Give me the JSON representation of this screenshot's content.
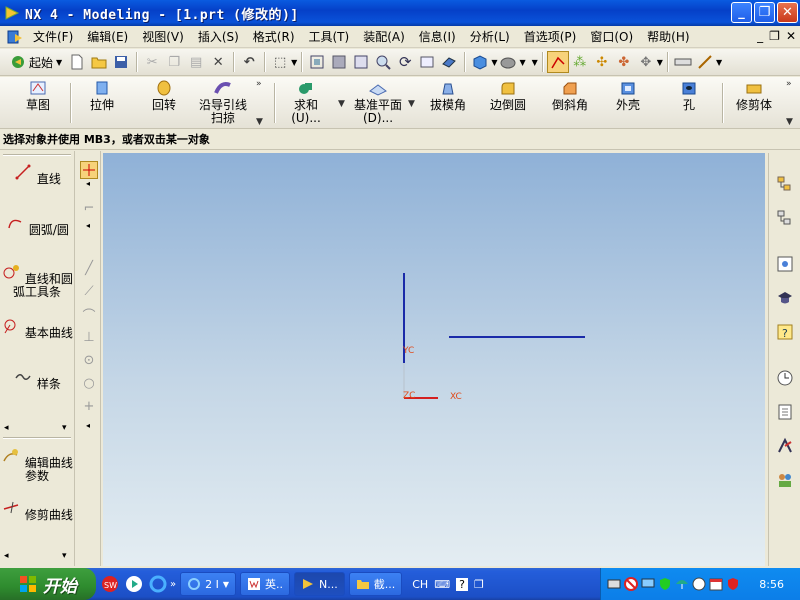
{
  "window": {
    "title": "NX 4 - Modeling - [1.prt (修改的)]",
    "minimize": "_",
    "restore": "❐",
    "close": "✕"
  },
  "menubar": {
    "items": [
      "文件(F)",
      "编辑(E)",
      "视图(V)",
      "插入(S)",
      "格式(R)",
      "工具(T)",
      "装配(A)",
      "信息(I)",
      "分析(L)",
      "首选项(P)",
      "窗口(O)",
      "帮助(H)"
    ],
    "mdi": {
      "minimize": "_",
      "restore": "❐",
      "close": "✕"
    }
  },
  "standard_toolbar": {
    "start_label": "起始"
  },
  "feature_toolbar": {
    "sketch": "草图",
    "extrude": "拉伸",
    "revolve": "回转",
    "sweep_line1": "沿导引线",
    "sweep_line2": "扫掠",
    "unite_line1": "求和",
    "unite_line2": "(U)...",
    "datum_line1": "基准平面",
    "datum_line2": "(D)...",
    "draft": "拔模角",
    "edge_blend": "边倒圆",
    "chamfer": "倒斜角",
    "shell": "外壳",
    "hole": "孔",
    "trim_body": "修剪体"
  },
  "cue_line": "选择对象并使用 MB3，或者双击某一对象",
  "left_panel": {
    "line": "直线",
    "arc": "圆弧/圆",
    "line_arc1": "直线和圆",
    "line_arc2": "弧工具条",
    "basic_curves": "基本曲线",
    "spline": "样条",
    "edit_curve1": "编辑曲线",
    "edit_curve2": "参数",
    "trim_curve": "修剪曲线"
  },
  "viewport": {
    "wcs_labels": {
      "y": "YC",
      "x": "XC",
      "z": "ZC"
    },
    "colors": {
      "axis_y": "#1a2aa8",
      "axis_x": "#d42020",
      "curve": "#1a2aa8",
      "label": "#e04a1a"
    }
  },
  "taskbar": {
    "start": "开始",
    "tasks": [
      {
        "label": "2 I",
        "icon": "ie-icon"
      },
      {
        "label": "英..",
        "icon": "word-icon"
      },
      {
        "label": "N...",
        "icon": "nx-icon"
      },
      {
        "label": "截...",
        "icon": "folder-icon"
      }
    ],
    "lang": "CH",
    "clock": "8:56"
  }
}
